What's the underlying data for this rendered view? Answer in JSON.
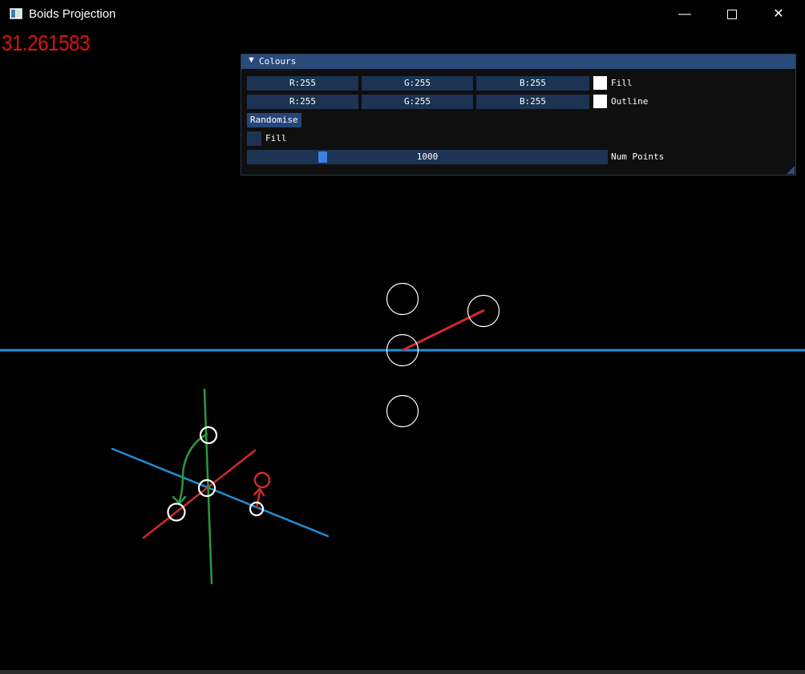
{
  "window": {
    "title": "Boids Projection",
    "minimize_icon": "minimize-icon",
    "maximize_icon": "maximize-icon",
    "close_icon": "close-icon"
  },
  "fps": "31.261583",
  "panel": {
    "title": "Colours",
    "collapse_icon": "▼",
    "fill_row": {
      "r": "R:255",
      "g": "G:255",
      "b": "B:255",
      "swatch_color": "#ffffff",
      "label": "Fill"
    },
    "outline_row": {
      "r": "R:255",
      "g": "G:255",
      "b": "B:255",
      "swatch_color": "#ffffff",
      "label": "Outline"
    },
    "randomise_label": "Randomise",
    "fill_checkbox_label": "Fill",
    "fill_checked": false,
    "num_points": {
      "value": "1000",
      "label": "Num Points",
      "fraction": 0.2
    }
  },
  "colors": {
    "background": "#000000",
    "accent": "#294a7a",
    "fps_text": "#d11111",
    "horizon_line": "#1f8fd6",
    "red_line": "#d12a2a",
    "green_line": "#2a9a3a",
    "circle": "#ffffff"
  }
}
